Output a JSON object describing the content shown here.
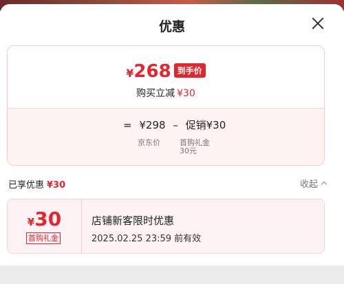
{
  "header": {
    "title": "优惠"
  },
  "price": {
    "currency": "¥",
    "final": "268",
    "final_tag": "到手价",
    "save_text": "购买立减",
    "save_amount": "¥30"
  },
  "breakdown": {
    "equals": "=",
    "jd_price": "¥298",
    "minus": "–",
    "promo": "促销¥30",
    "jd_label": "京东价",
    "gift_label": "首购礼金",
    "gift_amount": "30元"
  },
  "enjoyed": {
    "label": "已享优惠",
    "amount": "¥30",
    "collapse_label": "收起"
  },
  "coupon": {
    "currency": "¥",
    "amount": "30",
    "type": "首购礼金",
    "name": "店铺新客限时优惠",
    "expiry": "2025.02.25 23:59 前有效"
  },
  "colors": {
    "accent": "#e3262e",
    "card_bg": "#fdf2f3"
  }
}
